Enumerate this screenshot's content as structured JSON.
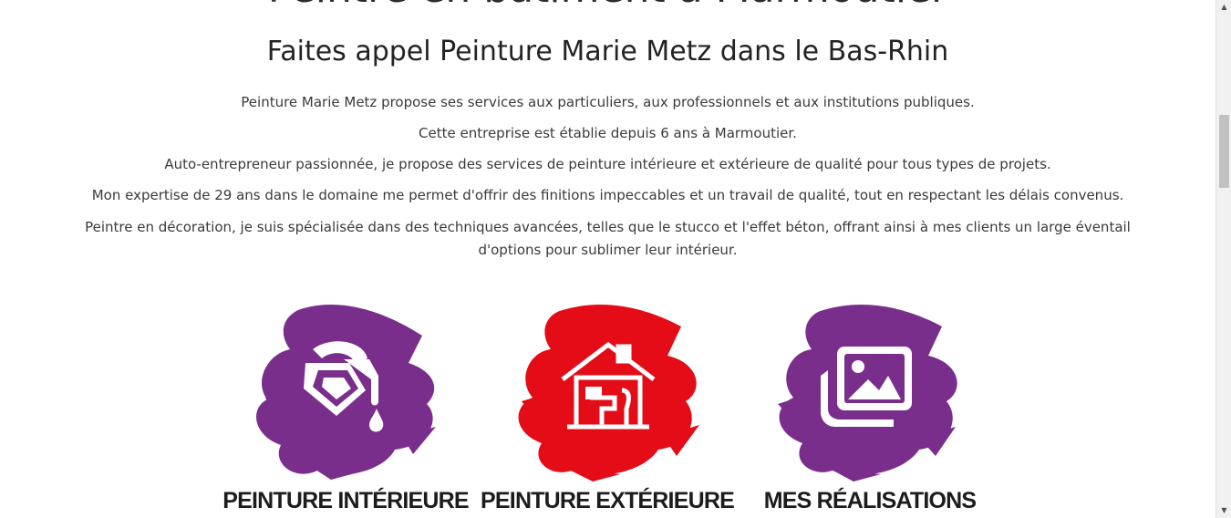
{
  "heading_top_cut": "Peintre en bâtiment à Marmoutier",
  "heading_sub": "Faites appel Peinture Marie Metz dans le Bas-Rhin",
  "intro": [
    "Peinture Marie Metz propose ses services aux particuliers, aux professionnels et aux institutions publiques.",
    "Cette entreprise est établie depuis 6 ans à Marmoutier.",
    "Auto-entrepreneur passionnée, je propose des services de peinture intérieure et extérieure de qualité pour tous types de projets.",
    "Mon expertise de 29 ans dans le domaine me permet d'offrir des finitions impeccables et un travail de qualité, tout en respectant les délais convenus.",
    "Peintre en décoration, je suis spécialisée dans des techniques avancées, telles que le stucco et l'effet béton, offrant ainsi à mes clients un large éventail d'options pour sublimer leur intérieur."
  ],
  "services": [
    {
      "title": "PEINTURE INTÉRIEURE",
      "icon": "paint-bucket-icon",
      "color": "#7a2e8c"
    },
    {
      "title": "PEINTURE EXTÉRIEURE",
      "icon": "house-paint-roller-icon",
      "color": "#e30c17"
    },
    {
      "title": "MES RÉALISATIONS",
      "icon": "photo-gallery-icon",
      "color": "#7a2e8c"
    }
  ]
}
